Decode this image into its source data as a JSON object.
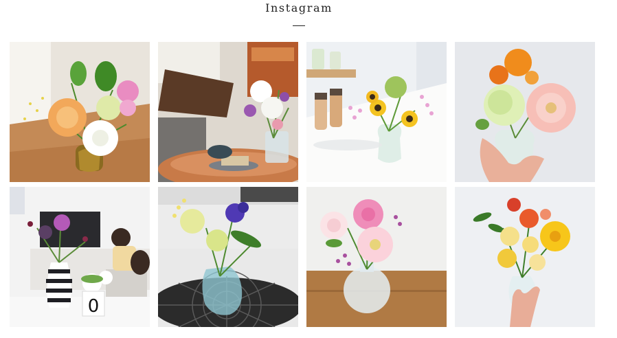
{
  "header": {
    "title": "Instagram"
  },
  "photos": [
    {
      "subject": "mixed-bouquet-in-gold-vase"
    },
    {
      "subject": "bouquet-on-cafe-table"
    },
    {
      "subject": "sunflower-bouquet-on-counter"
    },
    {
      "subject": "dahlia-bouquet-in-hand"
    },
    {
      "subject": "striped-vase-bouquet"
    },
    {
      "subject": "iris-bouquet-on-mat"
    },
    {
      "subject": "gerbera-rose-bouquet"
    },
    {
      "subject": "yellow-rose-bouquet-in-hand"
    }
  ],
  "vase_tag": "0",
  "colors": {
    "text": "#222222",
    "background": "#ffffff"
  }
}
